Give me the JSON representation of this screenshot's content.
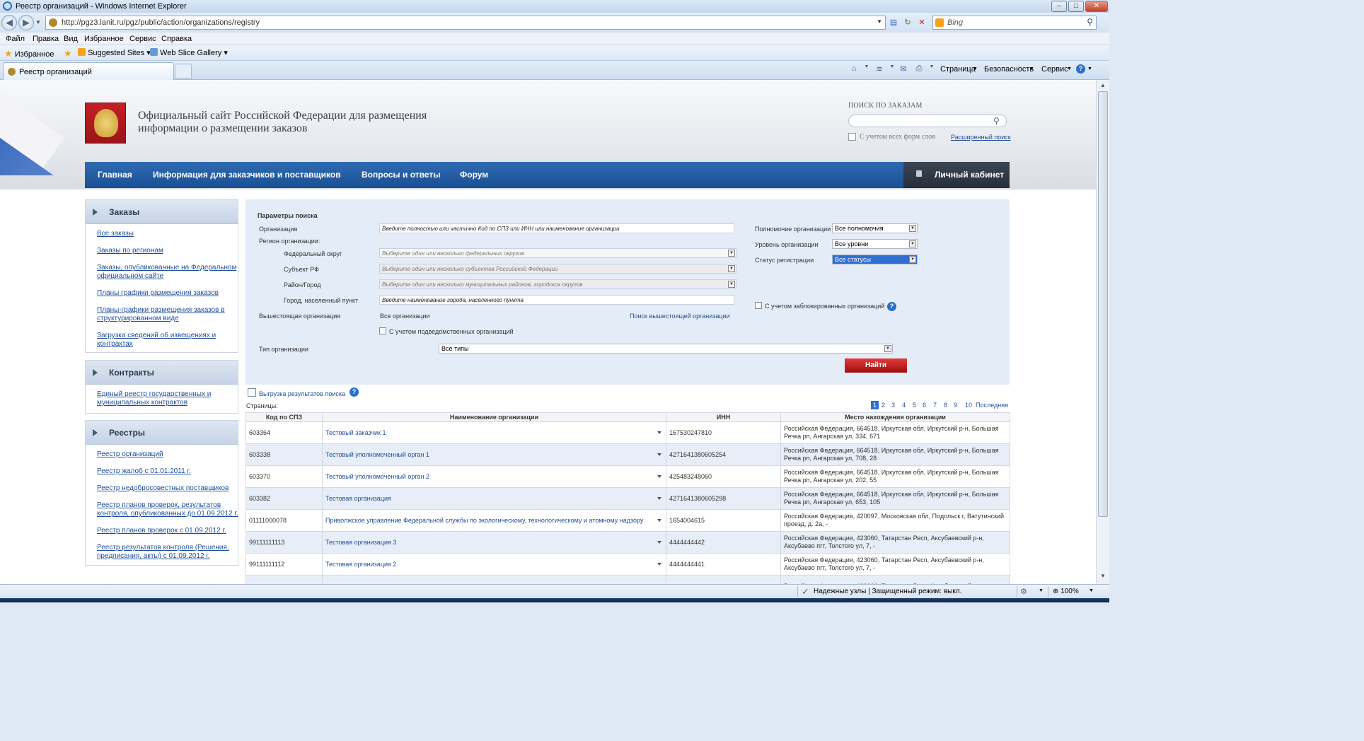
{
  "window": {
    "title": "Реестр организаций - Windows Internet Explorer"
  },
  "address": {
    "url": "http://pgz3.lanit.ru/pgz/public/action/organizations/registry",
    "bing_placeholder": "Bing"
  },
  "menu": [
    "Файл",
    "Правка",
    "Вид",
    "Избранное",
    "Сервис",
    "Справка"
  ],
  "favorites": {
    "label": "Избранное",
    "suggested": "Suggested Sites",
    "webslice": "Web Slice Gallery"
  },
  "tab": {
    "label": "Реестр организаций"
  },
  "command_bar": {
    "page": "Страница",
    "security": "Безопасность",
    "tools": "Сервис"
  },
  "header": {
    "site_title_line1": "Официальный сайт Российской Федерации для размещения",
    "site_title_line2": "информации о размещении заказов",
    "search_label": "ПОИСК ПО ЗАКАЗАМ",
    "wordforms_label": "С учетом всех форм слов",
    "advanced_search": "Расширенный поиск"
  },
  "nav": {
    "items": [
      "Главная",
      "Информация для заказчиков и поставщиков",
      "Вопросы и ответы",
      "Форум"
    ],
    "cabinet": "Личный кабинет"
  },
  "sidebar": {
    "orders": {
      "title": "Заказы",
      "links": [
        "Все заказы",
        "Заказы по регионам",
        "Заказы, опубликованные на Федеральном официальном сайте",
        "Планы графики размещения заказов",
        "Планы-графики размещения заказов в структурированном виде",
        "Загрузка сведений об извещениях и контрактах"
      ]
    },
    "contracts": {
      "title": "Контракты",
      "links": [
        "Единый реестр государственных и муниципальных контрактов"
      ]
    },
    "registries": {
      "title": "Реестры",
      "links": [
        "Реестр организаций",
        "Реестр жалоб с 01.01.2011 г.",
        "Реестр недобросовестных поставщиков",
        "Реестр планов проверок, результатов контроля, опубликованных до 01.09.2012 г.",
        "Реестр планов проверок с 01.09.2012 г.",
        "Реестр результатов контроля (Решения, предписания, акты) с 01.09.2012 г."
      ]
    }
  },
  "params": {
    "title": "Параметры поиска",
    "org_label": "Организация",
    "org_value": "Введите полностью или частично Код по СПЗ или ИНН или наименование организации",
    "region_label": "Регион организации:",
    "fed_district_label": "Федеральный округ",
    "fed_district_ph": "Выберите один или несколько федеральных округов",
    "subject_label": "Субъект РФ",
    "subject_ph": "Выберите один или несколько субъектов Российской Федерации",
    "district_label": "Район/Город",
    "district_ph": "Выберите один или несколько муниципальных районов, городских округов",
    "city_label": "Город, населенный пункт",
    "city_value": "Введите наименование города, населенного пункта",
    "parent_label": "Вышестоящая организация",
    "parent_value": "Все организации",
    "parent_search": "Поиск вышестоящей организации",
    "subordinate_label": "С учетом подведомственных организаций",
    "type_label": "Тип организации",
    "type_value": "Все типы",
    "authority_label": "Полномочие организации",
    "authority_value": "Все полномочия",
    "level_label": "Уровень организации",
    "level_value": "Все уровни",
    "status_label": "Статус регистрации",
    "status_value": "Все статусы",
    "blocked_label": "С учетом заблокированных организаций",
    "find_button": "Найти"
  },
  "results": {
    "export_link": "Выгрузка результатов поиска",
    "pages_label": "Страницы:",
    "pages": [
      "1",
      "2",
      "3",
      "4",
      "5",
      "6",
      "7",
      "8",
      "9",
      "10"
    ],
    "current_page": "1",
    "last_label": "Последняя",
    "columns": [
      "Код по СПЗ",
      "Наименование организации",
      "ИНН",
      "Место нахождения организации"
    ],
    "rows": [
      {
        "code": "603364",
        "name": "Тестовый заказчик 1",
        "inn": "167530247810",
        "address": "Российская Федерация, 664518, Иркутская обл, Иркутский р-н, Большая Речка рп, Ангарская ул, 334, 671"
      },
      {
        "code": "603338",
        "name": "Тестовый уполномоченный орган 1",
        "inn": "4271641380605254",
        "address": "Российская Федерация, 664518, Иркутская обл, Иркутский р-н, Большая Речка рп, Ангарская ул, 708, 28"
      },
      {
        "code": "603370",
        "name": "Тестовый уполномоченный орган 2",
        "inn": "425483248060",
        "address": "Российская Федерация, 664518, Иркутская обл, Иркутский р-н, Большая Речка рп, Ангарская ул, 202, 55"
      },
      {
        "code": "603382",
        "name": "Тестовая организация",
        "inn": "4271641380605298",
        "address": "Российская Федерация, 664518, Иркутская обл, Иркутский р-н, Большая Речка рп, Ангарская ул, 653, 105"
      },
      {
        "code": "01111000078",
        "name": "Приволжское управление Федеральной службы по экологическому, технологическому и атомному надзору",
        "inn": "1654004615",
        "address": "Российская Федерация, 420097, Московская обл, Подольск г, Ватутинский проезд, д. 2а, -"
      },
      {
        "code": "99111111113",
        "name": "Тестовая организация 3",
        "inn": "4444444442",
        "address": "Российская Федерация, 423060, Татарстан Респ, Аксубаевский р-н, Аксубаево пгт, Толстого ул, 7, -"
      },
      {
        "code": "99111111112",
        "name": "Тестовая организация 2",
        "inn": "4444444441",
        "address": "Российская Федерация, 423060, Татарстан Респ, Аксубаевский р-н, Аксубаево пгт, Толстого ул, 7, -"
      },
      {
        "code": "",
        "name": "",
        "inn": "",
        "address": "Российская Федерация, 423060, Татарстан Респ, Аксубаевский р-н,"
      }
    ]
  },
  "status": {
    "zone": "Надежные узлы | Защищенный режим: выкл.",
    "zoom": "100%"
  },
  "colors": {
    "nav_blue": "#1a4f93",
    "link_blue": "#1f4e9c",
    "find_red": "#c21e1e",
    "selected_blue": "#2f6fd0"
  }
}
